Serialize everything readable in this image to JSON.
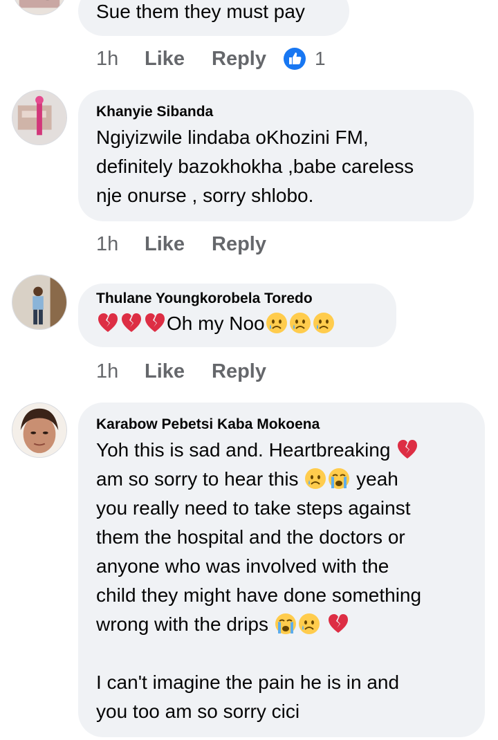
{
  "comments": [
    {
      "author": "",
      "lines": [
        "Sue them they must pay"
      ],
      "time": "1h",
      "like_label": "Like",
      "reply_label": "Reply",
      "like_count": "1"
    },
    {
      "author": "Khanyie Sibanda",
      "lines": [
        "Ngiyizwile lindaba oKhozini FM,",
        "definitely bazokhokha ,babe careless",
        "nje onurse , sorry shlobo."
      ],
      "time": "1h",
      "like_label": "Like",
      "reply_label": "Reply"
    },
    {
      "author": "Thulane Youngkorobela Toredo",
      "text": "Oh my Noo",
      "time": "1h",
      "like_label": "Like",
      "reply_label": "Reply"
    },
    {
      "author": "Karabow Pebetsi Kaba Mokoena",
      "lines": [
        "Yoh this is sad and. Heartbreaking",
        "am so sorry to hear this",
        "yeah",
        "you really need to take steps against",
        "them the hospital and the doctors or",
        "anyone who was involved with the",
        "child they might have done something",
        "wrong with the drips",
        "I can't imagine the pain he is in and",
        "you too am so sorry cici"
      ]
    }
  ],
  "icons": {
    "like_reaction": "thumbs-up-icon",
    "broken_heart": "broken-heart-emoji",
    "sad_face": "sad-tear-emoji",
    "crying_face": "loudly-crying-emoji"
  },
  "colors": {
    "bubble": "#f0f2f5",
    "meta_text": "#65676b",
    "like_blue": "#1877f2",
    "heart_red": "#dd2e44"
  }
}
